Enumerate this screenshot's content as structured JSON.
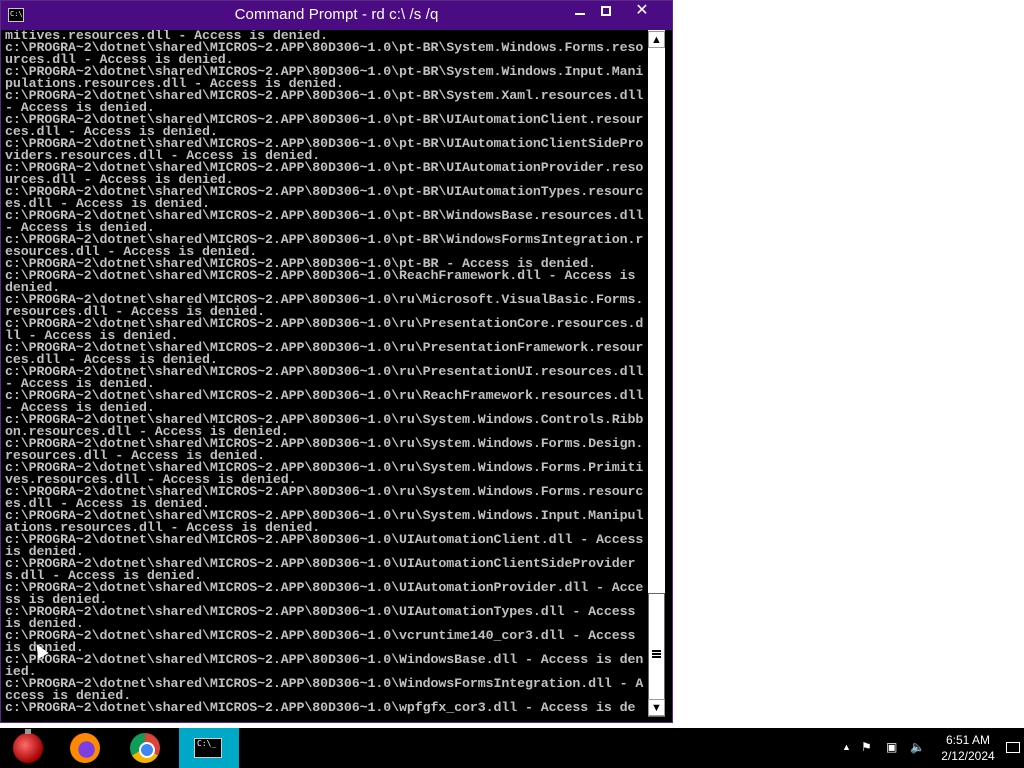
{
  "window": {
    "title": "Command Prompt - rd  c:\\ /s /q",
    "title_icon_text": "C:\\_",
    "controls": {
      "minimize": "minimize",
      "maximize": "maximize",
      "close": "✕"
    }
  },
  "console": {
    "lines": [
      "mitives.resources.dll - Access is denied.",
      "c:\\PROGRA~2\\dotnet\\shared\\MICROS~2.APP\\80D306~1.0\\pt-BR\\System.Windows.Forms.resources.dll - Access is denied.",
      "c:\\PROGRA~2\\dotnet\\shared\\MICROS~2.APP\\80D306~1.0\\pt-BR\\System.Windows.Input.Manipulations.resources.dll - Access is denied.",
      "c:\\PROGRA~2\\dotnet\\shared\\MICROS~2.APP\\80D306~1.0\\pt-BR\\System.Xaml.resources.dll - Access is denied.",
      "c:\\PROGRA~2\\dotnet\\shared\\MICROS~2.APP\\80D306~1.0\\pt-BR\\UIAutomationClient.resources.dll - Access is denied.",
      "c:\\PROGRA~2\\dotnet\\shared\\MICROS~2.APP\\80D306~1.0\\pt-BR\\UIAutomationClientSideProviders.resources.dll - Access is denied.",
      "c:\\PROGRA~2\\dotnet\\shared\\MICROS~2.APP\\80D306~1.0\\pt-BR\\UIAutomationProvider.resources.dll - Access is denied.",
      "c:\\PROGRA~2\\dotnet\\shared\\MICROS~2.APP\\80D306~1.0\\pt-BR\\UIAutomationTypes.resources.dll - Access is denied.",
      "c:\\PROGRA~2\\dotnet\\shared\\MICROS~2.APP\\80D306~1.0\\pt-BR\\WindowsBase.resources.dll - Access is denied.",
      "c:\\PROGRA~2\\dotnet\\shared\\MICROS~2.APP\\80D306~1.0\\pt-BR\\WindowsFormsIntegration.resources.dll - Access is denied.",
      "c:\\PROGRA~2\\dotnet\\shared\\MICROS~2.APP\\80D306~1.0\\pt-BR - Access is denied.",
      "c:\\PROGRA~2\\dotnet\\shared\\MICROS~2.APP\\80D306~1.0\\ReachFramework.dll - Access is denied.",
      "c:\\PROGRA~2\\dotnet\\shared\\MICROS~2.APP\\80D306~1.0\\ru\\Microsoft.VisualBasic.Forms.resources.dll - Access is denied.",
      "c:\\PROGRA~2\\dotnet\\shared\\MICROS~2.APP\\80D306~1.0\\ru\\PresentationCore.resources.dll - Access is denied.",
      "c:\\PROGRA~2\\dotnet\\shared\\MICROS~2.APP\\80D306~1.0\\ru\\PresentationFramework.resources.dll - Access is denied.",
      "c:\\PROGRA~2\\dotnet\\shared\\MICROS~2.APP\\80D306~1.0\\ru\\PresentationUI.resources.dll - Access is denied.",
      "c:\\PROGRA~2\\dotnet\\shared\\MICROS~2.APP\\80D306~1.0\\ru\\ReachFramework.resources.dll - Access is denied.",
      "c:\\PROGRA~2\\dotnet\\shared\\MICROS~2.APP\\80D306~1.0\\ru\\System.Windows.Controls.Ribbon.resources.dll - Access is denied.",
      "c:\\PROGRA~2\\dotnet\\shared\\MICROS~2.APP\\80D306~1.0\\ru\\System.Windows.Forms.Design.resources.dll - Access is denied.",
      "c:\\PROGRA~2\\dotnet\\shared\\MICROS~2.APP\\80D306~1.0\\ru\\System.Windows.Forms.Primitives.resources.dll - Access is denied.",
      "c:\\PROGRA~2\\dotnet\\shared\\MICROS~2.APP\\80D306~1.0\\ru\\System.Windows.Forms.resources.dll - Access is denied.",
      "c:\\PROGRA~2\\dotnet\\shared\\MICROS~2.APP\\80D306~1.0\\ru\\System.Windows.Input.Manipulations.resources.dll - Access is denied.",
      "c:\\PROGRA~2\\dotnet\\shared\\MICROS~2.APP\\80D306~1.0\\UIAutomationClient.dll - Access is denied.",
      "c:\\PROGRA~2\\dotnet\\shared\\MICROS~2.APP\\80D306~1.0\\UIAutomationClientSideProviders.dll - Access is denied.",
      "c:\\PROGRA~2\\dotnet\\shared\\MICROS~2.APP\\80D306~1.0\\UIAutomationProvider.dll - Access is denied.",
      "c:\\PROGRA~2\\dotnet\\shared\\MICROS~2.APP\\80D306~1.0\\UIAutomationTypes.dll - Access is denied.",
      "c:\\PROGRA~2\\dotnet\\shared\\MICROS~2.APP\\80D306~1.0\\vcruntime140_cor3.dll - Access is denied.",
      "c:\\PROGRA~2\\dotnet\\shared\\MICROS~2.APP\\80D306~1.0\\WindowsBase.dll - Access is denied.",
      "c:\\PROGRA~2\\dotnet\\shared\\MICROS~2.APP\\80D306~1.0\\WindowsFormsIntegration.dll - Access is denied.",
      "c:\\PROGRA~2\\dotnet\\shared\\MICROS~2.APP\\80D306~1.0\\wpfgfx_cor3.dll - Access is de"
    ]
  },
  "scrollbar": {
    "up_arrow": "▲",
    "down_arrow": "▼"
  },
  "taskbar": {
    "apps": [
      {
        "name": "ornament-icon"
      },
      {
        "name": "firefox-icon"
      },
      {
        "name": "chrome-icon"
      },
      {
        "name": "command-prompt-icon",
        "active": true,
        "icon_text": "C:\\_"
      }
    ],
    "tray": {
      "chevron": "▲",
      "flag": "⚑",
      "network": "▣",
      "volume": "🔈",
      "time": "6:51 AM",
      "date": "2/12/2024"
    }
  },
  "colors": {
    "titlebar": "#4b0b82",
    "console_bg": "#000000",
    "console_text": "#c0c0c0",
    "taskbar_bg": "#000000",
    "active_app": "#00a8c8"
  }
}
